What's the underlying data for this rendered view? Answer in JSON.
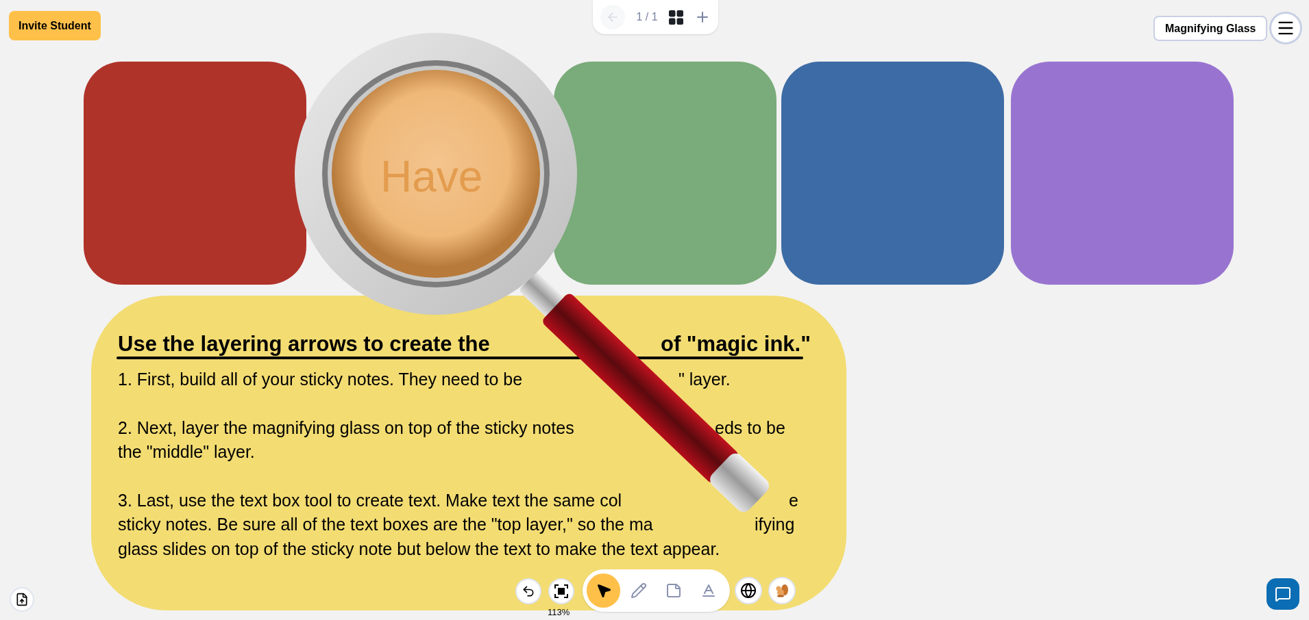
{
  "invite_button": "Invite Student",
  "page_nav": {
    "page": "1 / 1"
  },
  "mode_button": "Magnifying Glass",
  "sticky_notes": [
    {
      "color": "#b0332a"
    },
    {
      "color": "#7aab7a"
    },
    {
      "color": "#3d6ba5"
    },
    {
      "color": "#9874d0"
    }
  ],
  "magnifier": {
    "lens_text": "Have"
  },
  "instructions": {
    "title": [
      "Use the layering arrows to create the",
      "of \"magic ink.\""
    ],
    "lines": [
      [
        "1. First, build all of your sticky notes. They need to be",
        "\" layer."
      ],
      [
        "2. Next, layer the magnifying glass on top of the sticky notes",
        "eds to be"
      ],
      [
        "the \"middle\" layer."
      ],
      [
        "3. Last, use the text box tool to create text. Make text the same col",
        "e"
      ],
      [
        "sticky notes. Be sure all of the text boxes are the \"top layer,\" so the ma",
        "ifying"
      ],
      [
        "glass slides on top of the sticky note but below the text to make the text appear."
      ]
    ]
  },
  "toolbar": {
    "zoom": "113%",
    "tools": [
      {
        "kind": "select",
        "selected": true
      },
      {
        "kind": "pen",
        "selected": false
      },
      {
        "kind": "note",
        "selected": false
      },
      {
        "kind": "text",
        "selected": false
      }
    ]
  }
}
